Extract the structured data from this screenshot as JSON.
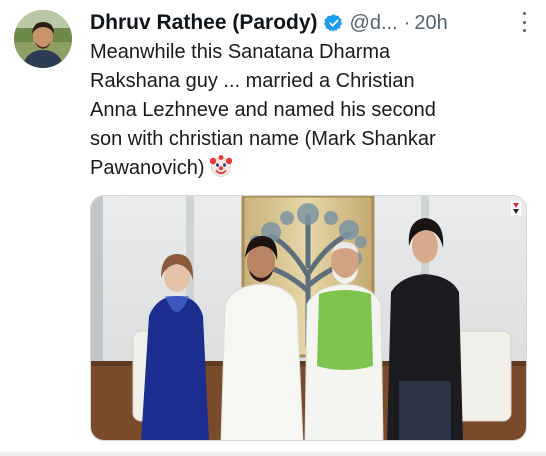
{
  "tweet": {
    "author_name": "Dhruv Rathee (Parody)",
    "handle": "@d...",
    "separator": "·",
    "time": "20h",
    "text_lines": [
      "Meanwhile this Sanatana Dharma",
      "Rakshana guy ... married a Christian",
      "Anna Lezhneve and named his second",
      "son with christian name (Mark Shankar",
      "Pawanovich)"
    ],
    "emoji": "clown-face-icon",
    "verified_color": "#1d9bf0"
  },
  "photo": {
    "watermark": "STAR"
  }
}
